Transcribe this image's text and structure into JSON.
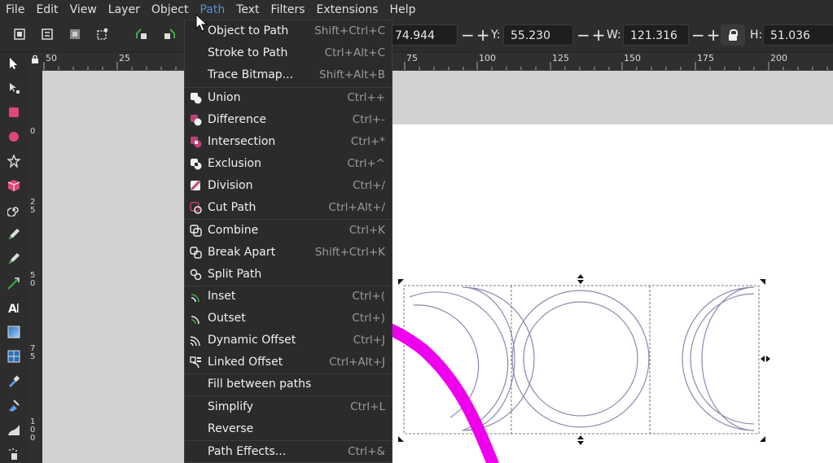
{
  "menubar": {
    "items": [
      "File",
      "Edit",
      "View",
      "Layer",
      "Object",
      "Path",
      "Text",
      "Filters",
      "Extensions",
      "Help"
    ],
    "active": "Path"
  },
  "toolbar": {
    "x_value": "74.944",
    "y_label": "Y:",
    "y_value": "55.230",
    "w_label": "W:",
    "w_value": "121.316",
    "h_label": "H:",
    "h_value": "51.036",
    "plus_minus": "−+"
  },
  "ruler": {
    "h_labels": [
      "50",
      "25",
      "75",
      "100",
      "125",
      "150",
      "175",
      "200"
    ],
    "v_labels": [
      "0",
      "2 5",
      "5 0",
      "7 5",
      "1 0 0"
    ]
  },
  "path_menu": {
    "items": [
      {
        "label": "Object to Path",
        "shortcut": "Shift+Ctrl+C",
        "icon": "none"
      },
      {
        "label": "Stroke to Path",
        "shortcut": "Ctrl+Alt+C",
        "icon": "none"
      },
      {
        "label": "Trace Bitmap...",
        "shortcut": "Shift+Alt+B",
        "icon": "none"
      },
      {
        "label": "Union",
        "shortcut": "Ctrl++",
        "icon": "union-icon"
      },
      {
        "label": "Difference",
        "shortcut": "Ctrl+-",
        "icon": "difference-icon"
      },
      {
        "label": "Intersection",
        "shortcut": "Ctrl+*",
        "icon": "intersection-icon"
      },
      {
        "label": "Exclusion",
        "shortcut": "Ctrl+^",
        "icon": "exclusion-icon"
      },
      {
        "label": "Division",
        "shortcut": "Ctrl+/",
        "icon": "division-icon"
      },
      {
        "label": "Cut Path",
        "shortcut": "Ctrl+Alt+/",
        "icon": "cut-path-icon"
      },
      {
        "label": "Combine",
        "shortcut": "Ctrl+K",
        "icon": "combine-icon"
      },
      {
        "label": "Break Apart",
        "shortcut": "Shift+Ctrl+K",
        "icon": "break-apart-icon"
      },
      {
        "label": "Split Path",
        "shortcut": "",
        "icon": "split-path-icon"
      },
      {
        "label": "Inset",
        "shortcut": "Ctrl+(",
        "icon": "inset-icon"
      },
      {
        "label": "Outset",
        "shortcut": "Ctrl+)",
        "icon": "outset-icon"
      },
      {
        "label": "Dynamic Offset",
        "shortcut": "Ctrl+J",
        "icon": "dynamic-offset-icon"
      },
      {
        "label": "Linked Offset",
        "shortcut": "Ctrl+Alt+J",
        "icon": "linked-offset-icon"
      },
      {
        "label": "Fill between paths",
        "shortcut": "",
        "icon": "none"
      },
      {
        "label": "Simplify",
        "shortcut": "Ctrl+L",
        "icon": "none"
      },
      {
        "label": "Reverse",
        "shortcut": "",
        "icon": "none"
      },
      {
        "label": "Path Effects...",
        "shortcut": "Ctrl+&",
        "icon": "none"
      }
    ]
  },
  "colors": {
    "accent_menu": "#5b8fd6",
    "boolean_icon": "#c2407a",
    "offset_icon": "#3fae4a",
    "annotation_arrow": "#ee00ee"
  }
}
